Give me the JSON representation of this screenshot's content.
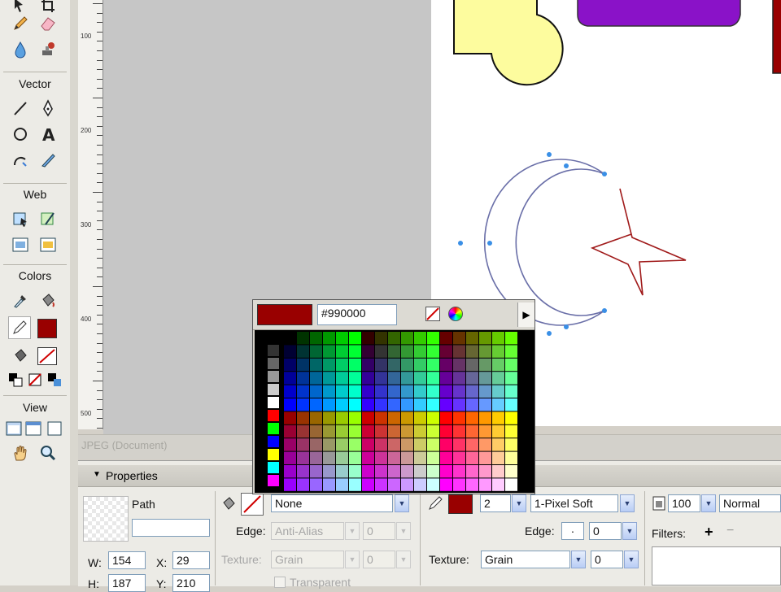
{
  "tools": {
    "vector_label": "Vector",
    "web_label": "Web",
    "colors_label": "Colors",
    "view_label": "View"
  },
  "ruler": {
    "labels": [
      "100",
      "200",
      "300",
      "400",
      "500"
    ]
  },
  "document": {
    "label": "JPEG (Document)"
  },
  "color_popup": {
    "hex_value": "#990000",
    "current_color": "#990000"
  },
  "properties": {
    "title": "Properties",
    "object_type": "Path",
    "name_value": "",
    "fill": {
      "type": "None",
      "edge_label": "Edge:",
      "edge_value": "Anti-Alias",
      "edge_amount": "0",
      "texture_label": "Texture:",
      "texture_value": "Grain",
      "texture_amount": "0",
      "transparent_label": "Transparent"
    },
    "stroke": {
      "color": "#990000",
      "size": "2",
      "type": "1-Pixel Soft",
      "edge_label": "Edge:",
      "edge_value": "0",
      "texture_label": "Texture:",
      "texture_value": "Grain",
      "texture_amount": "0"
    },
    "opacity": "100",
    "blend_mode": "Normal",
    "filters_label": "Filters:",
    "w_label": "W:",
    "w_value": "154",
    "x_label": "X:",
    "x_value": "29",
    "h_label": "H:",
    "h_value": "187",
    "y_label": "Y:",
    "y_value": "210"
  }
}
